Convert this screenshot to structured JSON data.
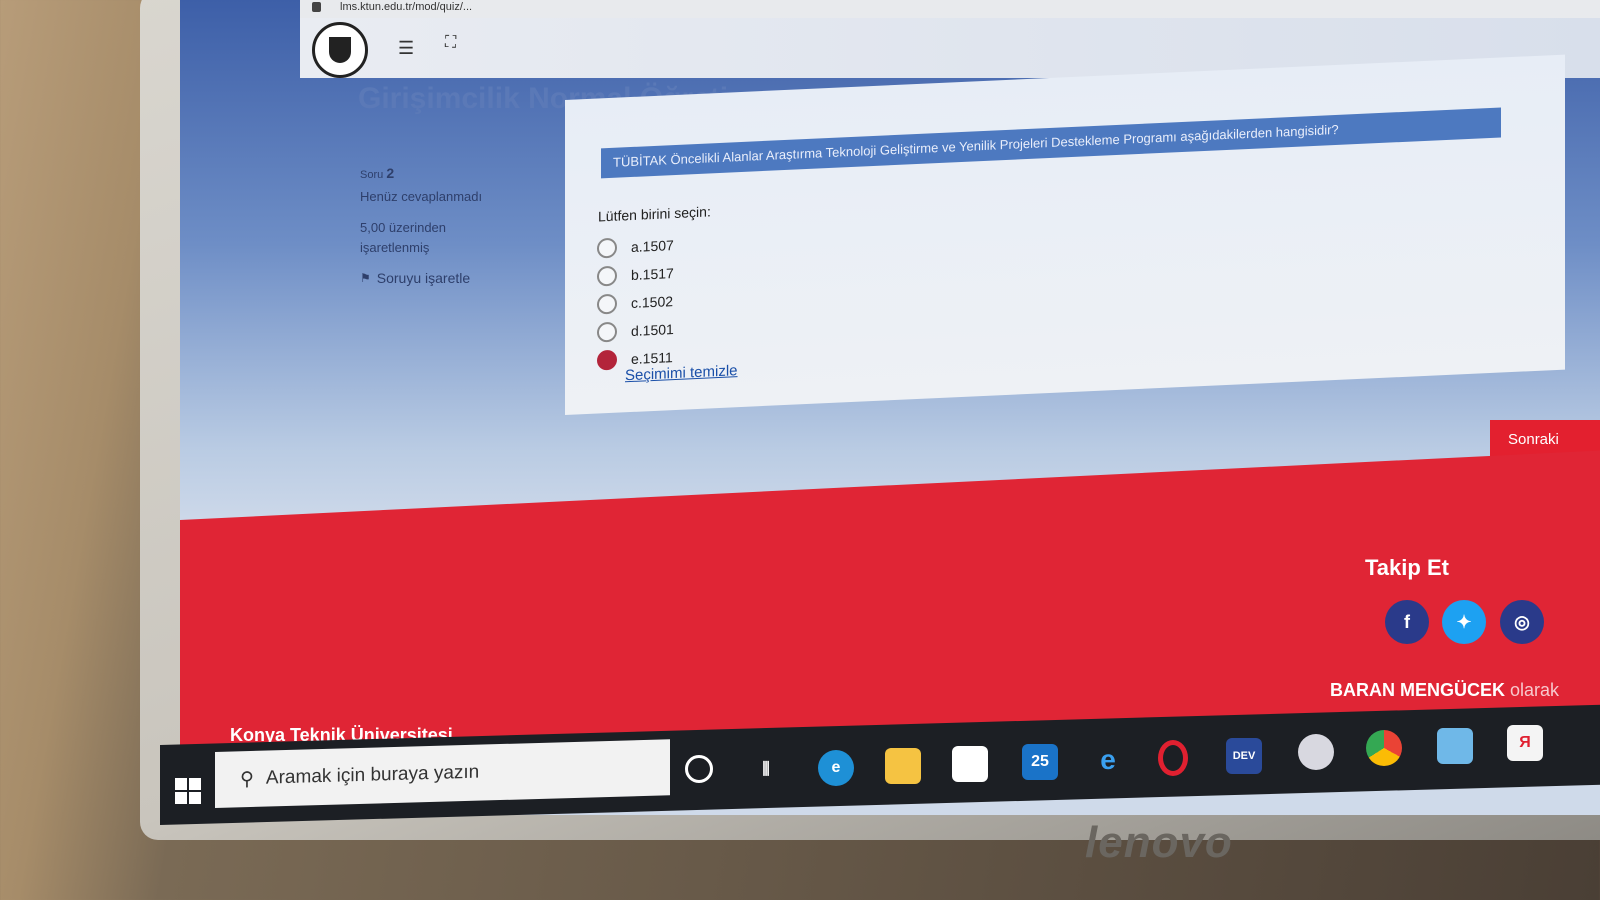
{
  "browser": {
    "url": "lms.ktun.edu.tr/mod/quiz/..."
  },
  "course": {
    "title": "Girişimcilik Normal Öğretim"
  },
  "sidebar": {
    "question_label": "Soru",
    "question_number": "2",
    "status": "Henüz cevaplanmadı",
    "grade_line1": "5,00 üzerinden",
    "grade_line2": "işaretlenmiş",
    "flag_label": "Soruyu işaretle"
  },
  "question": {
    "text": "TÜBİTAK Öncelikli Alanlar Araştırma Teknoloji Geliştirme ve Yenilik Projeleri Destekleme Programı aşağıdakilerden hangisidir?",
    "prompt": "Lütfen birini seçin:",
    "options": [
      {
        "label": "a.1507",
        "selected": false
      },
      {
        "label": "b.1517",
        "selected": false
      },
      {
        "label": "c.1502",
        "selected": false
      },
      {
        "label": "d.1501",
        "selected": false
      },
      {
        "label": "e.1511",
        "selected": true
      }
    ],
    "clear_label": "Seçimimi temizle"
  },
  "navigation": {
    "next_label": "Sonraki"
  },
  "footer": {
    "follow_title": "Takip Et",
    "social": [
      "facebook-icon",
      "twitter-icon",
      "instagram-icon"
    ],
    "credit_name": "BARAN MENGÜCEK",
    "credit_suffix": "olarak",
    "university": "Konya Teknik Üniversitesi"
  },
  "taskbar": {
    "search_placeholder": "Aramak için buraya yazın",
    "mail_badge": "25",
    "devcpp_label": "DEV"
  },
  "device": {
    "brand": "lenovo"
  },
  "colors": {
    "footer_red": "#e02535",
    "selected_radio": "#b3243a",
    "question_bar": "#4d79c0"
  }
}
